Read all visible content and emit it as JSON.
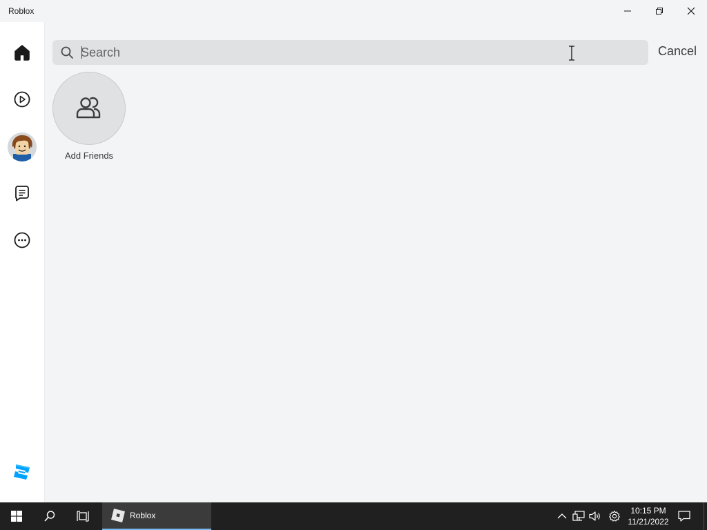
{
  "window": {
    "title": "Roblox",
    "controls": [
      "minimize-icon",
      "restore-icon",
      "close-icon"
    ]
  },
  "nav": {
    "items": [
      {
        "name": "home",
        "icon": "home-icon",
        "active": true
      },
      {
        "name": "discover",
        "icon": "play-circle-icon"
      },
      {
        "name": "avatar",
        "icon": "avatar-image"
      },
      {
        "name": "chat",
        "icon": "chat-icon"
      },
      {
        "name": "more",
        "icon": "more-icon"
      }
    ],
    "bottom_icon": "roblox-studio-icon"
  },
  "search": {
    "placeholder": "Search",
    "value": "",
    "icon": "search-icon",
    "cancel_label": "Cancel"
  },
  "friends": {
    "add_label": "Add Friends",
    "icon": "friends-icon"
  },
  "taskbar": {
    "app_label": "Roblox",
    "time": "10:15 PM",
    "date": "11/21/2022",
    "icons": [
      "windows-start-icon",
      "search-icon",
      "task-view-icon",
      "chevron-up-icon",
      "network-icon",
      "volume-icon",
      "settings-icon",
      "notification-icon"
    ]
  },
  "colors": {
    "background": "#f2f4f5",
    "nav_background": "#ffffff",
    "search_background": "#dfe1e2",
    "text": "#393b3d",
    "taskbar": "#202020",
    "studio_blue": "#00a2ff"
  }
}
